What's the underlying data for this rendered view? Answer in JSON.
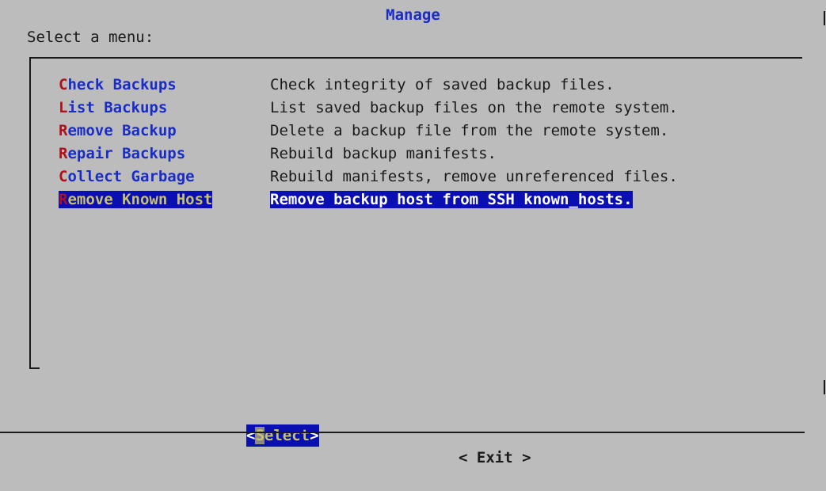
{
  "dialog": {
    "title": "Manage",
    "prompt": "Select a menu:"
  },
  "menu": {
    "items": [
      {
        "hotkey": "C",
        "rest": "heck Backups",
        "description": "Check integrity of saved backup files.",
        "selected": false
      },
      {
        "hotkey": "L",
        "rest": "ist Backups",
        "description": "List saved backup files on the remote system.",
        "selected": false
      },
      {
        "hotkey": "R",
        "rest": "emove Backup",
        "description": "Delete a backup file from the remote system.",
        "selected": false
      },
      {
        "hotkey": "R",
        "rest": "epair Backups",
        "description": "Rebuild backup manifests.",
        "selected": false
      },
      {
        "hotkey": "C",
        "rest": "ollect Garbage",
        "description": "Rebuild manifests, remove unreferenced files.",
        "selected": false
      },
      {
        "hotkey": "R",
        "rest": "emove Known Host",
        "description": "Remove backup host from SSH known_hosts.",
        "selected": true
      }
    ]
  },
  "buttons": {
    "select": {
      "open": "<",
      "cursor": "S",
      "rest": "elect",
      "close": ">"
    },
    "exit": "< Exit >"
  },
  "colors": {
    "background": "#bcbcbc",
    "title": "#1a2cc8",
    "hotkey": "#b0101a",
    "highlight": "#0a10b0",
    "highlight_text": "#c8c270"
  }
}
